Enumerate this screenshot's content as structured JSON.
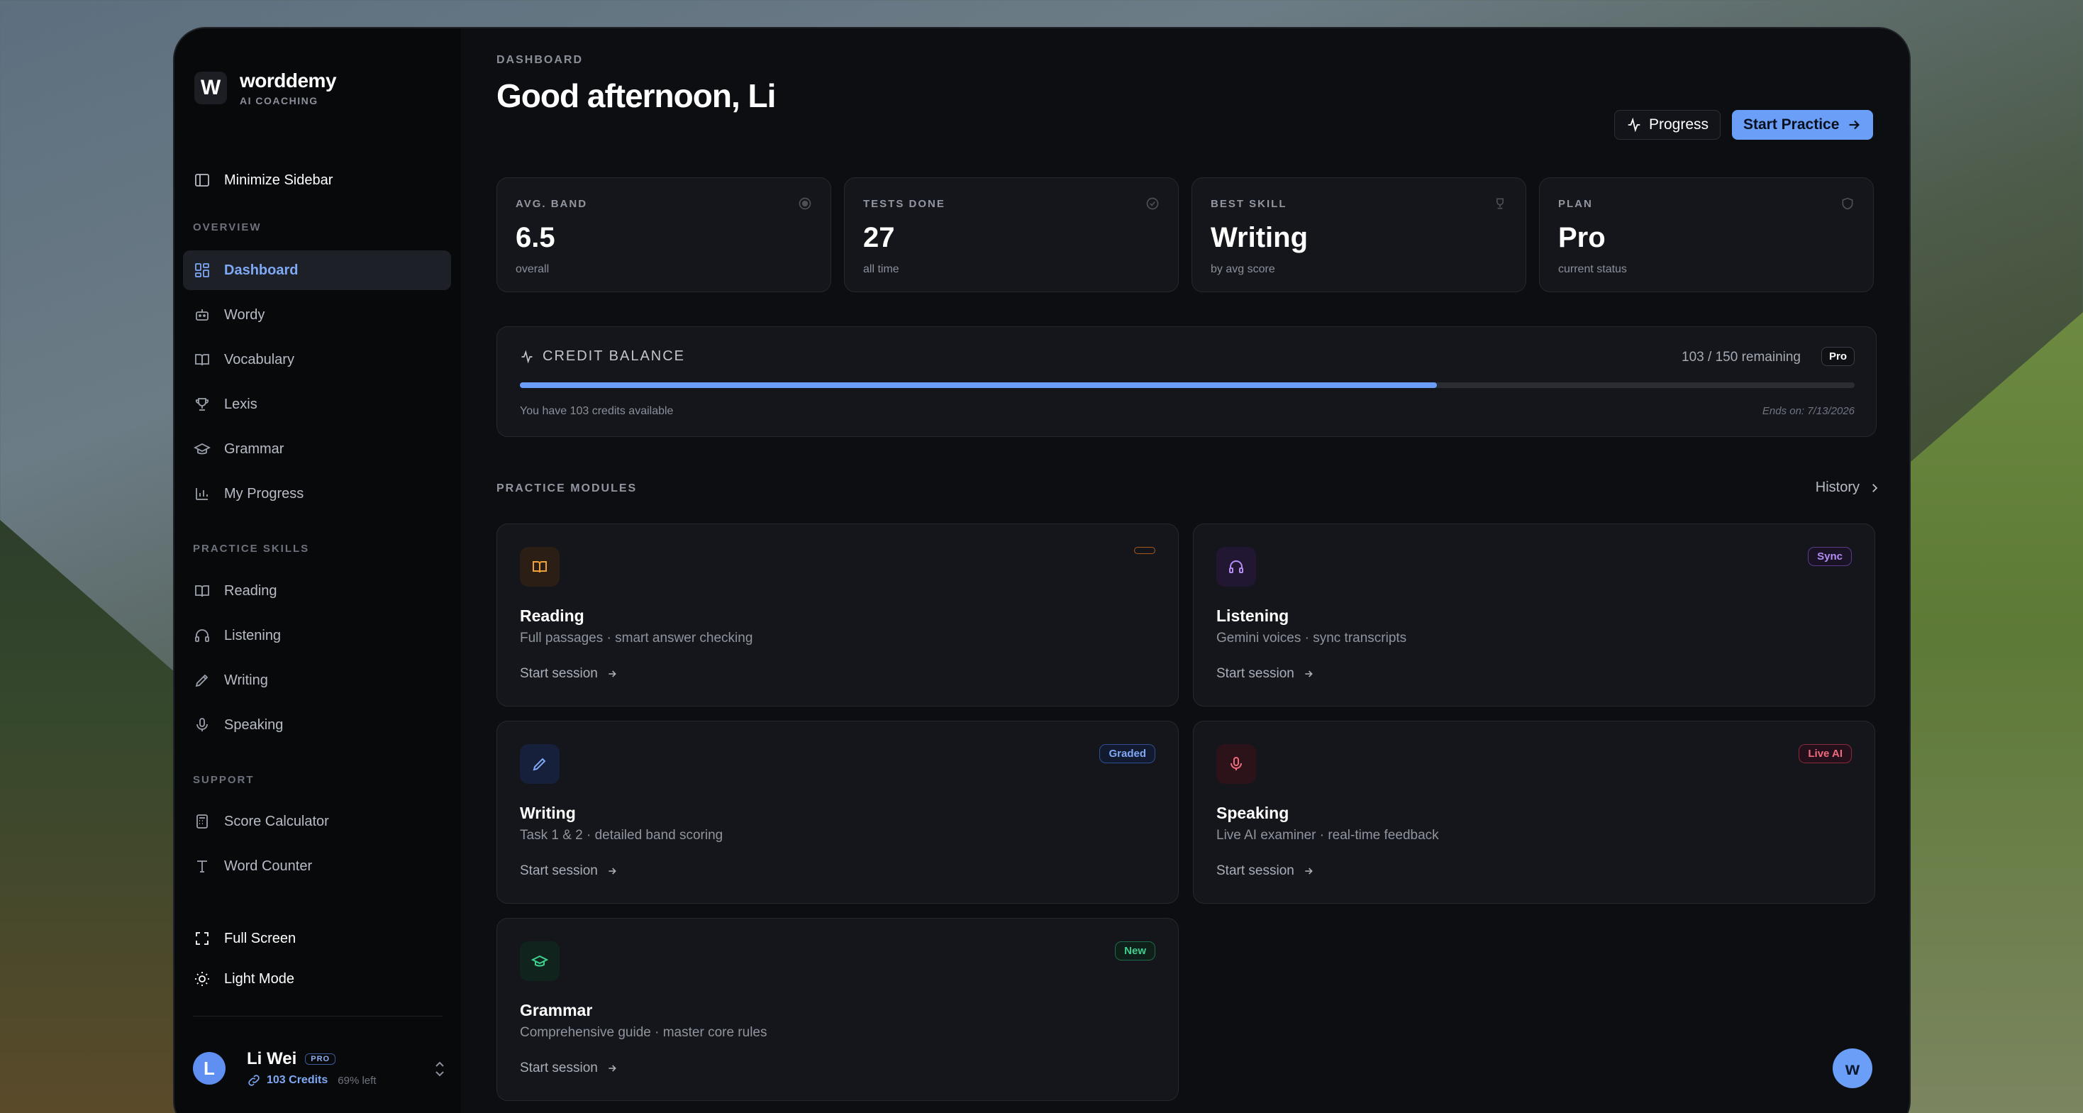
{
  "brand": {
    "mark": "W",
    "name": "worddemy",
    "subtitle": "AI COACHING"
  },
  "sidebar": {
    "minimize_label": "Minimize Sidebar",
    "sections": {
      "overview": "OVERVIEW",
      "practice": "PRACTICE SKILLS",
      "support": "SUPPORT"
    },
    "overview_items": [
      {
        "label": "Dashboard",
        "icon": "grid-icon",
        "active": true
      },
      {
        "label": "Wordy",
        "icon": "robot-icon"
      },
      {
        "label": "Vocabulary",
        "icon": "book-icon"
      },
      {
        "label": "Lexis",
        "icon": "trophy-icon"
      },
      {
        "label": "Grammar",
        "icon": "graduation-cap-icon"
      },
      {
        "label": "My Progress",
        "icon": "bar-chart-icon"
      }
    ],
    "practice_items": [
      {
        "label": "Reading",
        "icon": "book-open-icon"
      },
      {
        "label": "Listening",
        "icon": "headphones-icon"
      },
      {
        "label": "Writing",
        "icon": "pen-icon"
      },
      {
        "label": "Speaking",
        "icon": "microphone-icon"
      }
    ],
    "support_items": [
      {
        "label": "Score Calculator",
        "icon": "calculator-icon"
      },
      {
        "label": "Word Counter",
        "icon": "text-icon"
      }
    ],
    "bottom_items": [
      {
        "label": "Full Screen",
        "icon": "fullscreen-icon"
      },
      {
        "label": "Light Mode",
        "icon": "sun-icon"
      }
    ],
    "user": {
      "initial": "L",
      "name": "Li Wei",
      "plan_tag": "PRO",
      "credits": "103 Credits",
      "left": "69% left"
    }
  },
  "header": {
    "breadcrumb": "DASHBOARD",
    "title": "Good afternoon, Li",
    "progress_button": "Progress",
    "start_button": "Start Practice"
  },
  "stats": [
    {
      "label": "AVG. BAND",
      "value": "6.5",
      "sub": "overall",
      "icon": "target-icon"
    },
    {
      "label": "TESTS DONE",
      "value": "27",
      "sub": "all time",
      "icon": "check-circle-icon"
    },
    {
      "label": "BEST SKILL",
      "value": "Writing",
      "sub": "by avg score",
      "icon": "trophy-icon"
    },
    {
      "label": "PLAN",
      "value": "Pro",
      "sub": "current status",
      "icon": "shield-icon"
    }
  ],
  "credit": {
    "title": "CREDIT BALANCE",
    "remaining": "103 / 150 remaining",
    "tag": "Pro",
    "fill_fraction": 0.687,
    "note": "You have 103 credits available",
    "ends": "Ends on: 7/13/2026"
  },
  "modules": {
    "heading": "PRACTICE MODULES",
    "history_label": "History",
    "cards": [
      {
        "title": "Reading",
        "desc": "Full passages · smart answer checking",
        "cta": "Start session",
        "badge": "",
        "icon": "book-open-icon"
      },
      {
        "title": "Listening",
        "desc": "Gemini voices · sync transcripts",
        "cta": "Start session",
        "badge": "Sync",
        "icon": "headphones-icon"
      },
      {
        "title": "Writing",
        "desc": "Task 1 & 2 · detailed band scoring",
        "cta": "Start session",
        "badge": "Graded",
        "icon": "pen-icon"
      },
      {
        "title": "Speaking",
        "desc": "Live AI examiner · real-time feedback",
        "cta": "Start session",
        "badge": "Live AI",
        "icon": "microphone-icon"
      },
      {
        "title": "Grammar",
        "desc": "Comprehensive guide · master core rules",
        "cta": "Start session",
        "badge": "New",
        "icon": "graduation-cap-icon"
      }
    ]
  },
  "fab": {
    "label": "w"
  },
  "colors": {
    "accent": "#6b9ef7",
    "background": "#0d0e12",
    "card": "#14161b"
  }
}
